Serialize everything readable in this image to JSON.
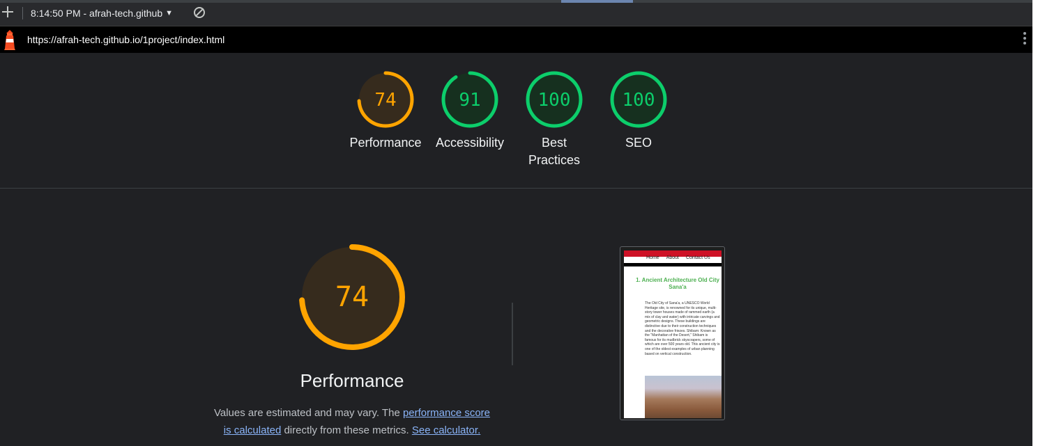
{
  "toolbar": {
    "session_label": "8:14:50 PM - afrah-tech.github"
  },
  "urlbar": {
    "url": "https://afrah-tech.github.io/1project/index.html"
  },
  "colors": {
    "pass": "#0cce6b",
    "average": "#ffa400",
    "pass_bg": "#16301f",
    "average_bg": "#362b1d"
  },
  "categories": [
    {
      "label": "Performance",
      "score": "74",
      "value": 74,
      "status": "average"
    },
    {
      "label": "Accessibility",
      "score": "91",
      "value": 91,
      "status": "pass"
    },
    {
      "label_lines": [
        "Best",
        "Practices"
      ],
      "score": "100",
      "value": 100,
      "status": "pass"
    },
    {
      "label": "SEO",
      "score": "100",
      "value": 100,
      "status": "pass"
    }
  ],
  "performance": {
    "score": "74",
    "value": 74,
    "title": "Performance",
    "desc_prefix": "Values are estimated and may vary. The ",
    "desc_link1": "performance score is calculated",
    "desc_middle": " directly from these metrics. ",
    "desc_link2": "See calculator."
  },
  "thumbnail": {
    "nav": [
      "Home",
      "About",
      "Contact Us"
    ],
    "heading": "1. Ancient Architecture Old City Sana'a",
    "paragraph": "The Old City of Sana'a, a UNESCO World Heritage site, is renowned for its unique, multi-story tower houses made of rammed earth (a mix of clay and water) with intricate carvings and geometric designs. These buildings are distinctive due to their construction techniques and the decorative friezes. Shibam: Known as the \"Manhattan of the Desert,\" Shibam is famous for its mudbrick skyscrapers, some of which are over 500 years old. This ancient city is one of the oldest examples of urban planning based on vertical construction."
  }
}
